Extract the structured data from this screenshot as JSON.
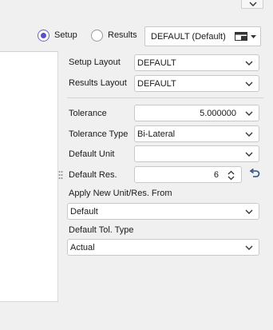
{
  "mode": {
    "setup_label": "Setup",
    "results_label": "Results",
    "selected": "Setup",
    "layout_value": "DEFAULT (Default)"
  },
  "fields": {
    "setup_layout": {
      "label": "Setup Layout",
      "value": "DEFAULT"
    },
    "results_layout": {
      "label": "Results Layout",
      "value": "DEFAULT"
    },
    "tolerance": {
      "label": "Tolerance",
      "value": "5.000000"
    },
    "tolerance_type": {
      "label": "Tolerance Type",
      "value": "Bi-Lateral"
    },
    "default_unit": {
      "label": "Default Unit",
      "value": ""
    },
    "default_res": {
      "label": "Default Res.",
      "value": "6"
    },
    "apply_from": {
      "label": "Apply New Unit/Res. From",
      "value": "Default"
    },
    "default_tol_type": {
      "label": "Default Tol. Type",
      "value": "Actual"
    }
  },
  "icons": {
    "top": "chevron-down-icon",
    "layout": "layout-picker-icon",
    "dropdown": "chevron-down-icon",
    "spinner": "spinner-icon",
    "grip": "drag-grip-icon",
    "undo": "undo-icon"
  },
  "colors": {
    "radio_accent": "#5a50c0",
    "background": "#f0f0f0",
    "field_bg": "#ffffff"
  }
}
